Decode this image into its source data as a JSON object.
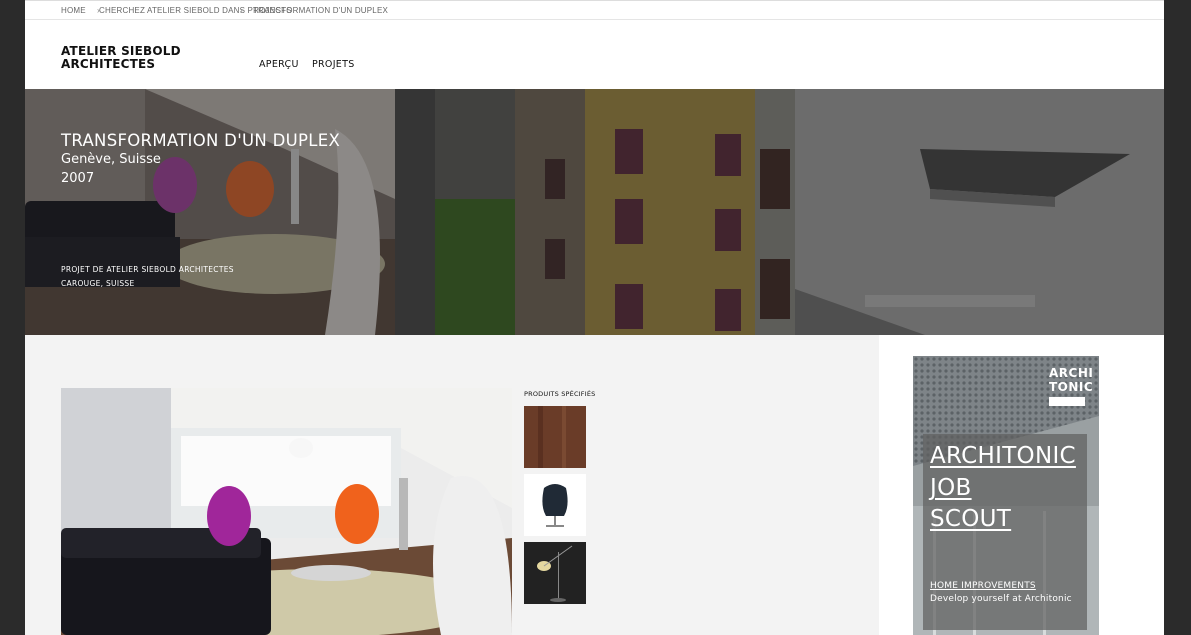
{
  "breadcrumb": {
    "home": "HOME",
    "search": "CHERCHEZ ATELIER SIEBOLD DANS PROJECTS",
    "current": "TRANSFORMATION D'UN DUPLEX",
    "separator": "›"
  },
  "header": {
    "logo_line1": "ATELIER SIEBOLD",
    "logo_line2": "ARCHITECTES",
    "nav": [
      "APERÇU",
      "PROJETS"
    ]
  },
  "hero": {
    "title": "TRANSFORMATION D'UN DUPLEX",
    "location": "Genève, Suisse",
    "year": "2007",
    "credit_line1": "PROJET DE ATELIER SIEBOLD ARCHITECTES",
    "credit_line2": "CAROUGE, SUISSE"
  },
  "products": {
    "label": "PRODUITS SPÉCIFIÉS",
    "items": [
      "wood-panel-thumb",
      "egg-chair-thumb",
      "floor-lamp-thumb"
    ]
  },
  "ad": {
    "logo_line1": "ARCHI",
    "logo_line2": "TONIC",
    "headline": [
      "ARCHITONIC",
      "JOB",
      "SCOUT"
    ],
    "subhead": "HOME IMPROVEMENTS",
    "tagline": "Develop yourself at Architonic"
  },
  "colors": {
    "background": "#2b2b2b",
    "content_gray": "#f3f3f3",
    "chair_magenta": "#a0269a",
    "chair_orange": "#f0621c"
  }
}
